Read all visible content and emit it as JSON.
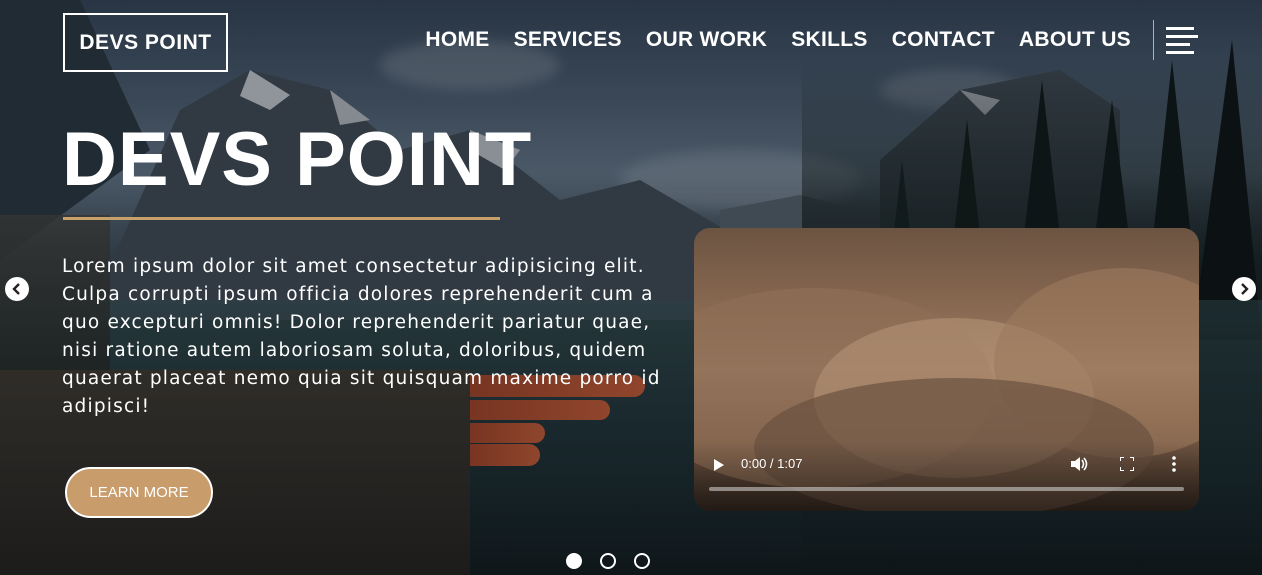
{
  "brand": {
    "logo_text": "DEVS POINT"
  },
  "nav": {
    "items": [
      {
        "label": "HOME"
      },
      {
        "label": "SERVICES"
      },
      {
        "label": "OUR WORK"
      },
      {
        "label": "SKILLS"
      },
      {
        "label": "CONTACT"
      },
      {
        "label": "ABOUT US"
      }
    ],
    "menu_icon": "hamburger-menu-icon"
  },
  "hero": {
    "title": "DEVS POINT",
    "description": "Lorem ipsum dolor sit amet consectetur adipisicing elit. Culpa corrupti ipsum officia dolores reprehenderit cum a quo excepturi omnis! Dolor reprehenderit pariatur quae, nisi ratione autem laboriosam soluta, doloribus, quidem quaerat placeat nemo quia sit quisquam maxime porro id adipisci!",
    "cta_label": "LEARN MORE"
  },
  "video": {
    "time_display": "0:00 / 1:07",
    "progress": 0
  },
  "carousel": {
    "slide_count": 3,
    "active_slide": 1
  },
  "colors": {
    "accent": "#c99c6c",
    "rule": "#c8a06a"
  }
}
